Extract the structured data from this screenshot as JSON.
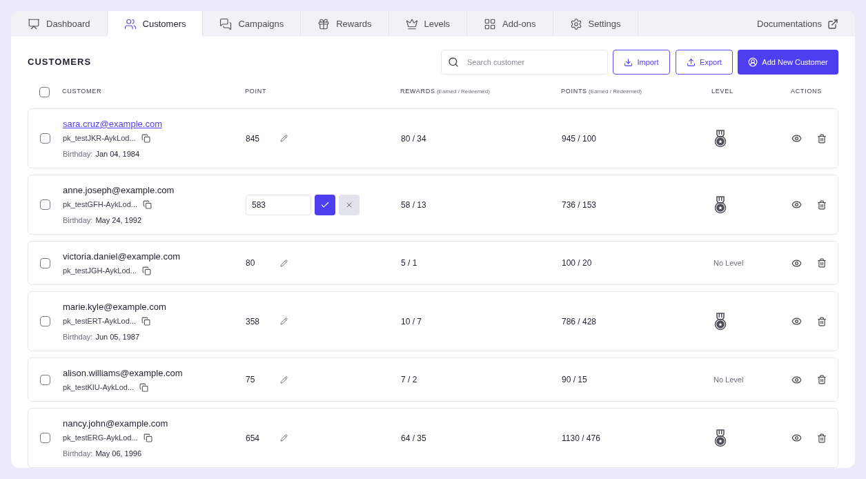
{
  "tabs": [
    {
      "label": "Dashboard",
      "selected": false
    },
    {
      "label": "Customers",
      "selected": true
    },
    {
      "label": "Campaigns",
      "selected": false
    },
    {
      "label": "Rewards",
      "selected": false
    },
    {
      "label": "Levels",
      "selected": false
    },
    {
      "label": "Add-ons",
      "selected": false
    },
    {
      "label": "Settings",
      "selected": false
    }
  ],
  "documentation_link": "Documentations",
  "page_title": "CUSTOMERS",
  "search": {
    "placeholder": "Search customer"
  },
  "buttons": {
    "import": "Import",
    "export": "Export",
    "add": "Add New Customer"
  },
  "table": {
    "select_all_checked": false,
    "columns": [
      {
        "label": "CUSTOMER"
      },
      {
        "label": "POINT"
      },
      {
        "label": "REWARDS",
        "note": "(Earned / Redeemed)"
      },
      {
        "label": "POINTS",
        "note": "(Earned / Redeemed)"
      },
      {
        "label": "LEVEL"
      },
      {
        "label": "ACTIONS"
      }
    ],
    "rows": [
      {
        "checked": false,
        "email": "sara.cruz@example.com",
        "email_link": true,
        "key": "pk_testJKR-AykLod...",
        "birthday_label": "Birthday:",
        "birthday": "Jan 04, 1984",
        "point": "845",
        "editing": false,
        "rewards": "80 / 34",
        "points": "945 / 100",
        "level": {
          "kind": "medal"
        }
      },
      {
        "checked": false,
        "email": "anne.joseph@example.com",
        "email_link": false,
        "key": "pk_testGFH-AykLod...",
        "birthday_label": "Birthday:",
        "birthday": "May 24, 1992",
        "point": "583",
        "editing": true,
        "rewards": "58 / 13",
        "points": "736 / 153",
        "level": {
          "kind": "medal"
        }
      },
      {
        "checked": false,
        "email": "victoria.daniel@example.com",
        "email_link": false,
        "key": "pk_testJGH-AykLod...",
        "point": "80",
        "editing": false,
        "rewards": "5 / 1",
        "points": "100 / 20",
        "level": {
          "kind": "none",
          "text": "No Level"
        }
      },
      {
        "checked": false,
        "email": "marie.kyle@example.com",
        "email_link": false,
        "key": "pk_testERT-AykLod...",
        "birthday_label": "Birthday:",
        "birthday": "Jun 05, 1987",
        "point": "358",
        "editing": false,
        "rewards": "10 / 7",
        "points": "786 / 428",
        "level": {
          "kind": "medal"
        }
      },
      {
        "checked": false,
        "email": "alison.williams@example.com",
        "email_link": false,
        "key": "pk_testKIU-AykLod...",
        "point": "75",
        "editing": false,
        "rewards": "7 / 2",
        "points": "90 / 15",
        "level": {
          "kind": "none",
          "text": "No Level"
        }
      },
      {
        "checked": false,
        "email": "nancy.john@example.com",
        "email_link": false,
        "key": "pk_testERG-AykLod...",
        "birthday_label": "Birthday:",
        "birthday": "May 06, 1996",
        "point": "654",
        "editing": false,
        "rewards": "64 / 35",
        "points": "1130 / 476",
        "level": {
          "kind": "medal"
        }
      }
    ]
  }
}
